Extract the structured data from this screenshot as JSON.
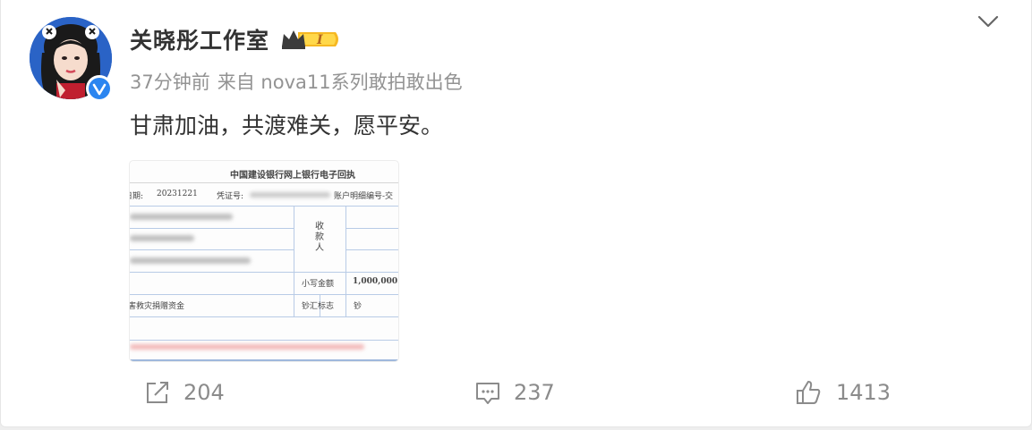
{
  "post": {
    "author": "关晓彤工作室",
    "vip_level": "I",
    "time": "37分钟前",
    "source": "来自 nova11系列敢拍敢出色",
    "text": "甘肃加油，共渡难关，愿平安。"
  },
  "receipt": {
    "title": "中国建设银行网上银行电子回执",
    "date_label": "日期:",
    "date_value": "20231221",
    "voucher_label": "凭证号:",
    "account_label": "账户明细编号-交",
    "payee_label": "收款人",
    "amount_label": "小写金额",
    "amount_value": "1,000,000.",
    "purpose": "害救灾捐赠资金",
    "cash_flag_label": "钞汇标志",
    "cash_flag_value": "钞"
  },
  "actions": {
    "repost_count": "204",
    "comment_count": "237",
    "like_count": "1413"
  },
  "colors": {
    "verified_blue": "#2b85f0",
    "vip_gold": "#f6b822",
    "text_primary": "#333333",
    "text_secondary": "#939393"
  },
  "icons": [
    "verified-icon",
    "vip-crown-icon",
    "chevron-down-icon",
    "repost-icon",
    "comment-icon",
    "like-icon"
  ]
}
